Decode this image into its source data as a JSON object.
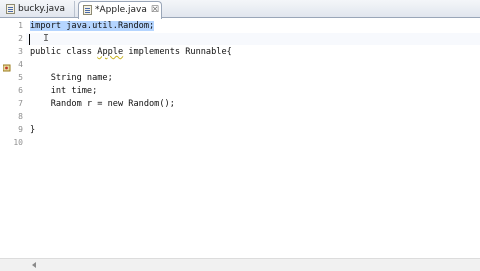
{
  "tabs": [
    {
      "label": "bucky.java"
    },
    {
      "label": "*Apple.java",
      "close": "☒"
    }
  ],
  "line_numbers": [
    "1",
    "2",
    "3",
    "4",
    "5",
    "6",
    "7",
    "8",
    "9",
    "10"
  ],
  "code": {
    "l1": "import java.util.Random;",
    "l3a": "public class ",
    "l3b": "Apple",
    "l3c": " implements Runnable{",
    "l5": "    String name;",
    "l6": "    int time;",
    "l7": "    Random r = new Random();",
    "l9": "}"
  },
  "colors": {
    "selection": "#b5d5ff",
    "warning": "#c7b21f"
  }
}
